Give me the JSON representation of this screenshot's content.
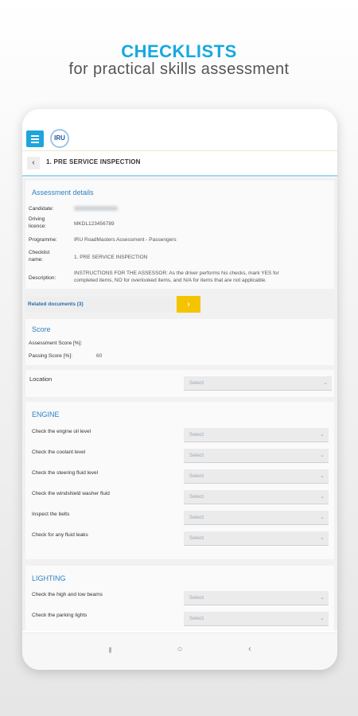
{
  "promo": {
    "headline": "CHECKLISTS",
    "subhead": "for practical skills assessment"
  },
  "app": {
    "logo_text": "IRU",
    "page_title": "1. PRE SERVICE INSPECTION",
    "back_glyph": "‹",
    "colors": {
      "accent": "#1da5dc",
      "section": "#2b82c4",
      "yellow": "#f5c400"
    }
  },
  "assessment": {
    "title": "Assessment details",
    "candidate_label": "Candidate:",
    "driving_licence_label_1": "Driving",
    "driving_licence_label_2": "licence:",
    "driving_licence": "MKDL123456789",
    "programme_label": "Programme:",
    "programme": "IRU RoadMasters Assessment - Passengers",
    "checklist_label_1": "Checklist",
    "checklist_label_2": "name:",
    "checklist_name": "1. PRE SERVICE INSPECTION",
    "description_label": "Description:",
    "description_1": "INSTRUCTIONS FOR THE ASSESSOR: As the driver performs his checks, mark YES for",
    "description_2": "completed items, NO for overlooked items, and N/A for items that are not applicable."
  },
  "related": {
    "label": "Related documents (3)",
    "button_glyph": "›"
  },
  "score": {
    "title": "Score",
    "assessment_label": "Assessment Score [%]:",
    "passing_label": "Passing Score [%]:",
    "passing_value": "60"
  },
  "location": {
    "label": "Location",
    "placeholder": "Select"
  },
  "engine": {
    "title": "ENGINE",
    "items": [
      {
        "label": "Check the engine oil level",
        "placeholder": "Select"
      },
      {
        "label": "Check the coolant level",
        "placeholder": "Select"
      },
      {
        "label": "Check the steering fluid level",
        "placeholder": "Select"
      },
      {
        "label": "Check the windshield washer fluid",
        "placeholder": "Select"
      },
      {
        "label": "Inspect the belts",
        "placeholder": "Select"
      },
      {
        "label": "Check for any fluid leaks",
        "placeholder": "Select"
      }
    ]
  },
  "lighting": {
    "title": "LIGHTING",
    "items": [
      {
        "label": "Check the high and low beams",
        "placeholder": "Select"
      },
      {
        "label": "Check the parking lights",
        "placeholder": "Select"
      }
    ]
  },
  "icons": {
    "menu": "hamburger-icon",
    "back": "chevron-left-icon",
    "dropdown": "chevron-down-icon",
    "arrow": "chevron-right-icon"
  },
  "navbar": {
    "recent": "|||",
    "home": "○",
    "back": "‹"
  }
}
